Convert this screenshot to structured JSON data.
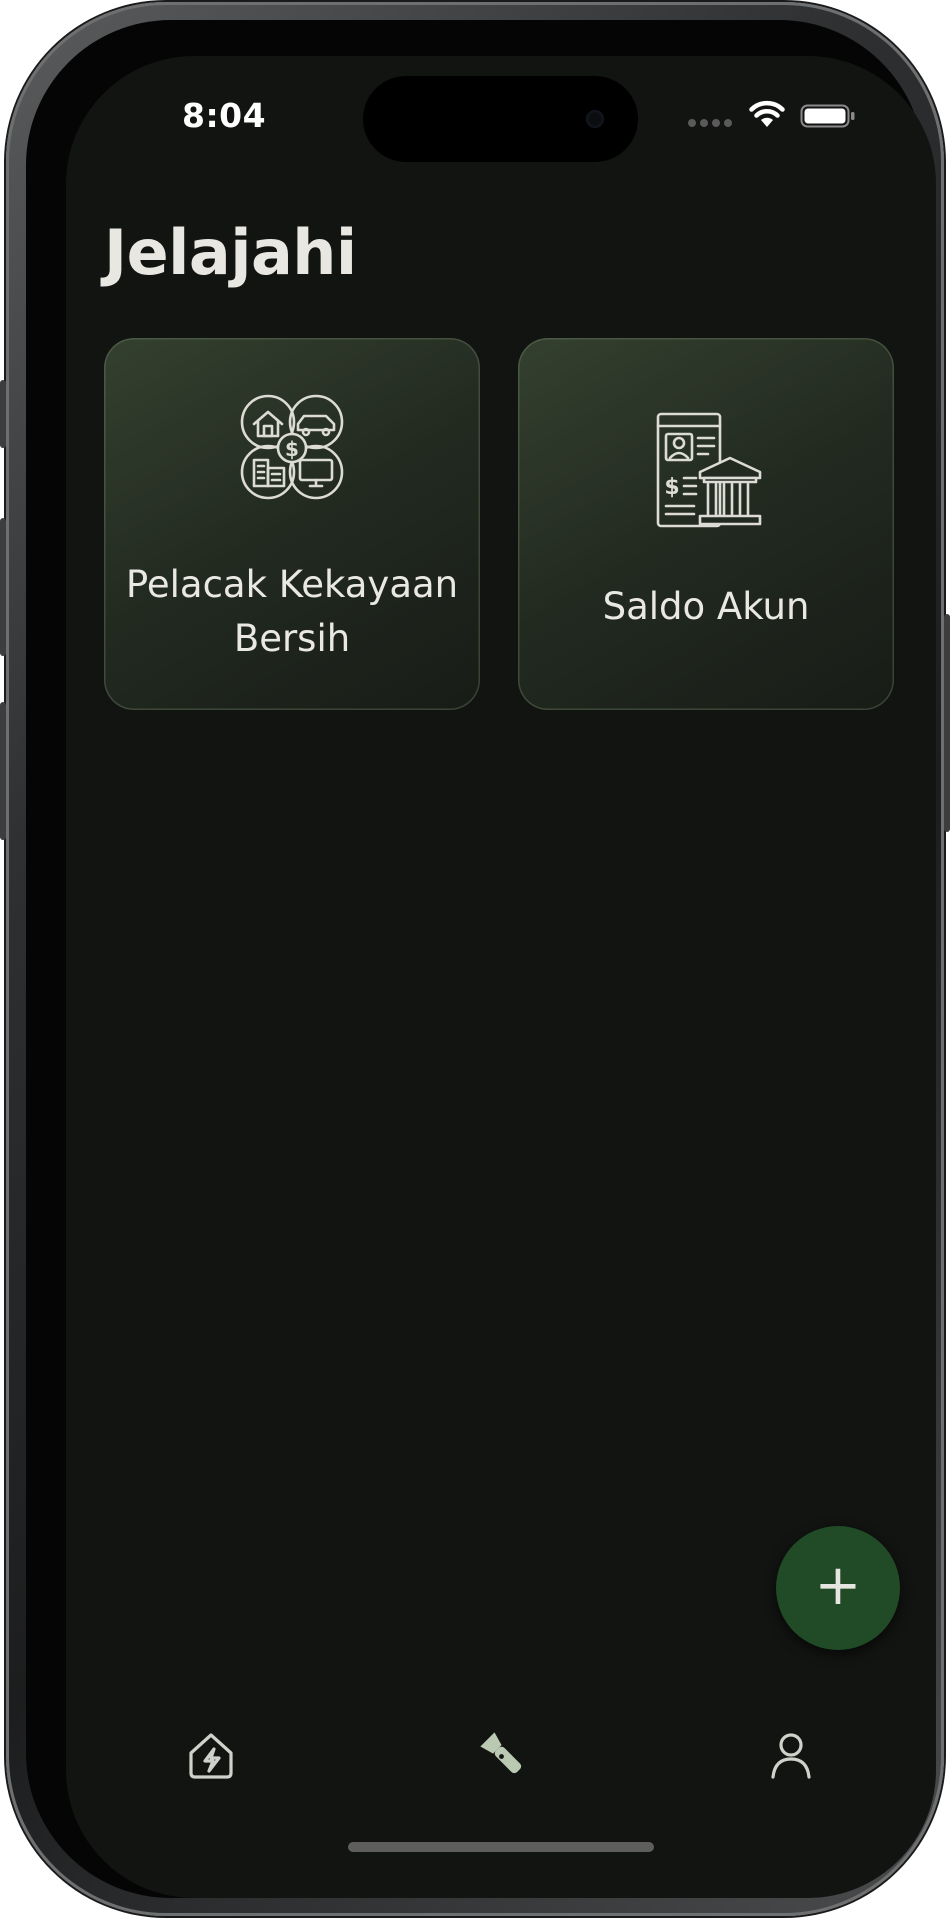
{
  "status_bar": {
    "time": "8:04",
    "wifi_icon": "wifi-icon",
    "battery_icon": "battery-icon"
  },
  "header": {
    "title": "Jelajahi"
  },
  "cards": [
    {
      "label": "Pelacak Kekayaan Bersih",
      "icon": "net-worth-assets-icon"
    },
    {
      "label": "Saldo Akun",
      "icon": "bank-account-statement-icon"
    }
  ],
  "fab": {
    "label": "+",
    "icon": "plus-icon"
  },
  "bottom_nav": {
    "items": [
      {
        "name": "home",
        "icon": "home-bolt-icon",
        "active": false
      },
      {
        "name": "explore",
        "icon": "flashlight-icon",
        "active": true
      },
      {
        "name": "profile",
        "icon": "user-icon",
        "active": false
      }
    ]
  },
  "colors": {
    "background": "#121411",
    "card_gradient_start": "#34402f",
    "card_gradient_end": "#181c17",
    "fab": "#214a27",
    "text_primary": "#e8e7e1",
    "nav_active": "#b9c9b2",
    "nav_inactive": "#c9cbc4"
  }
}
